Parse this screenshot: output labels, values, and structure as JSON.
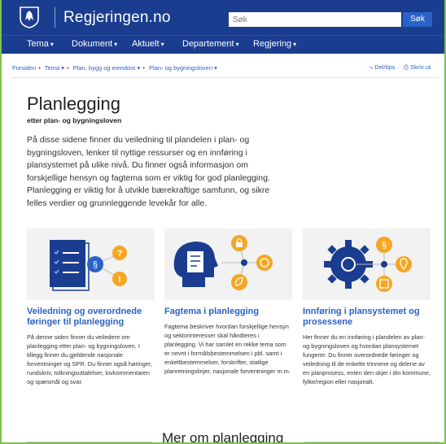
{
  "header": {
    "site_name": "Regjeringen.no",
    "search_placeholder": "Søk",
    "search_button": "Søk"
  },
  "nav": {
    "items": [
      {
        "label": "Tema"
      },
      {
        "label": "Dokument"
      },
      {
        "label": "Aktuelt"
      },
      {
        "label": "Departement"
      },
      {
        "label": "Regjering"
      }
    ]
  },
  "breadcrumb": {
    "items": [
      "Forsiden",
      "Tema",
      "Plan, bygg og eiendom",
      "Plan- og bygningsloven"
    ]
  },
  "tools": {
    "share": "Del/tips",
    "print": "Skriv ut"
  },
  "page": {
    "title": "Planlegging",
    "subtitle": "etter plan- og bygningsloven",
    "intro": "På disse sidene finner du veiledning til plandelen i plan- og bygningsloven, lenker til nyttige ressurser og en innføring i plansystemet på ulike nivå. Du finner også informasjon om forskjellige hensyn og fagtema som er viktig for god planlegging. Planlegging er viktig for å utvikle bærekraftige samfunn, og sikre felles verdier og grunnleggende levekår for alle."
  },
  "cards": [
    {
      "title": "Veiledning og overordnede føringer til planlegging",
      "text": "På denne siden finner du veiledere om planlegging etter plan- og bygningsloven. I tillegg finner du gjeldende nasjonale forventninger og SPR. Du finner også høringer, rundskriv, tolkningsuttalelser, lovkommentaren og spørsmål og svar.",
      "icon": "document-checklist-icon"
    },
    {
      "title": "Fagtema i planlegging",
      "text": "Fagtema beskriver hvordan forskjellige hensyn og sektorinteresser skal håndteres i planlegging. Vi har samlet en rekke tema som er nevnt i formålsbestemmelsen i pbl. samt i enkeltbestemmelser, forskrifter, statlige planretningslinjer, nasjonale forventninger m.m.",
      "icon": "head-document-icon"
    },
    {
      "title": "Innføring i plansystemet og prosessene",
      "text": "Her finner du en innføring i plandelen av plan- og bygningsloven og hvordan plansystemet fungerer. Du finner overordnede føringer og veiledning til de enkelte trinnene og delene av en planprosess, enten den skjer i din kommune, fylke/region eller nasjonalt.",
      "icon": "gear-icon"
    }
  ],
  "more": {
    "title": "Mer om planlegging"
  },
  "colors": {
    "header_bg": "#1a3d8f",
    "link": "#2a62c8",
    "accent_orange": "#f5a623",
    "frame_green": "#7fc24a"
  }
}
